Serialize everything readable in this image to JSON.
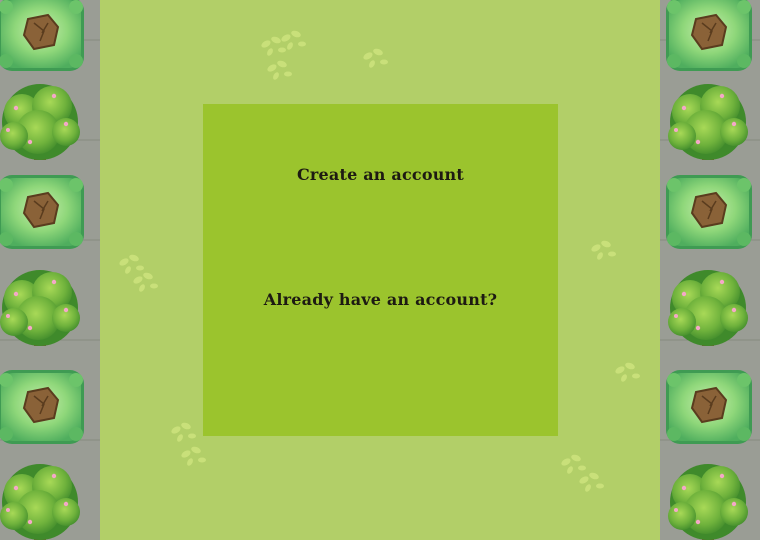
{
  "menu": {
    "create_account_label": "Create an account",
    "login_prompt_label": "Already have an account?"
  },
  "colors": {
    "lawn": "#b2cf68",
    "panel": "#9bc42d",
    "stone_wall": "#9a9d95",
    "hedge": "#7ccf63",
    "bush": "#6fb23c",
    "tree_stump": "#7a5633",
    "text": "#1d1a12"
  },
  "icons": [
    "tree-stump-hedge-icon",
    "flowering-bush-icon",
    "grass-tuft-icon"
  ]
}
